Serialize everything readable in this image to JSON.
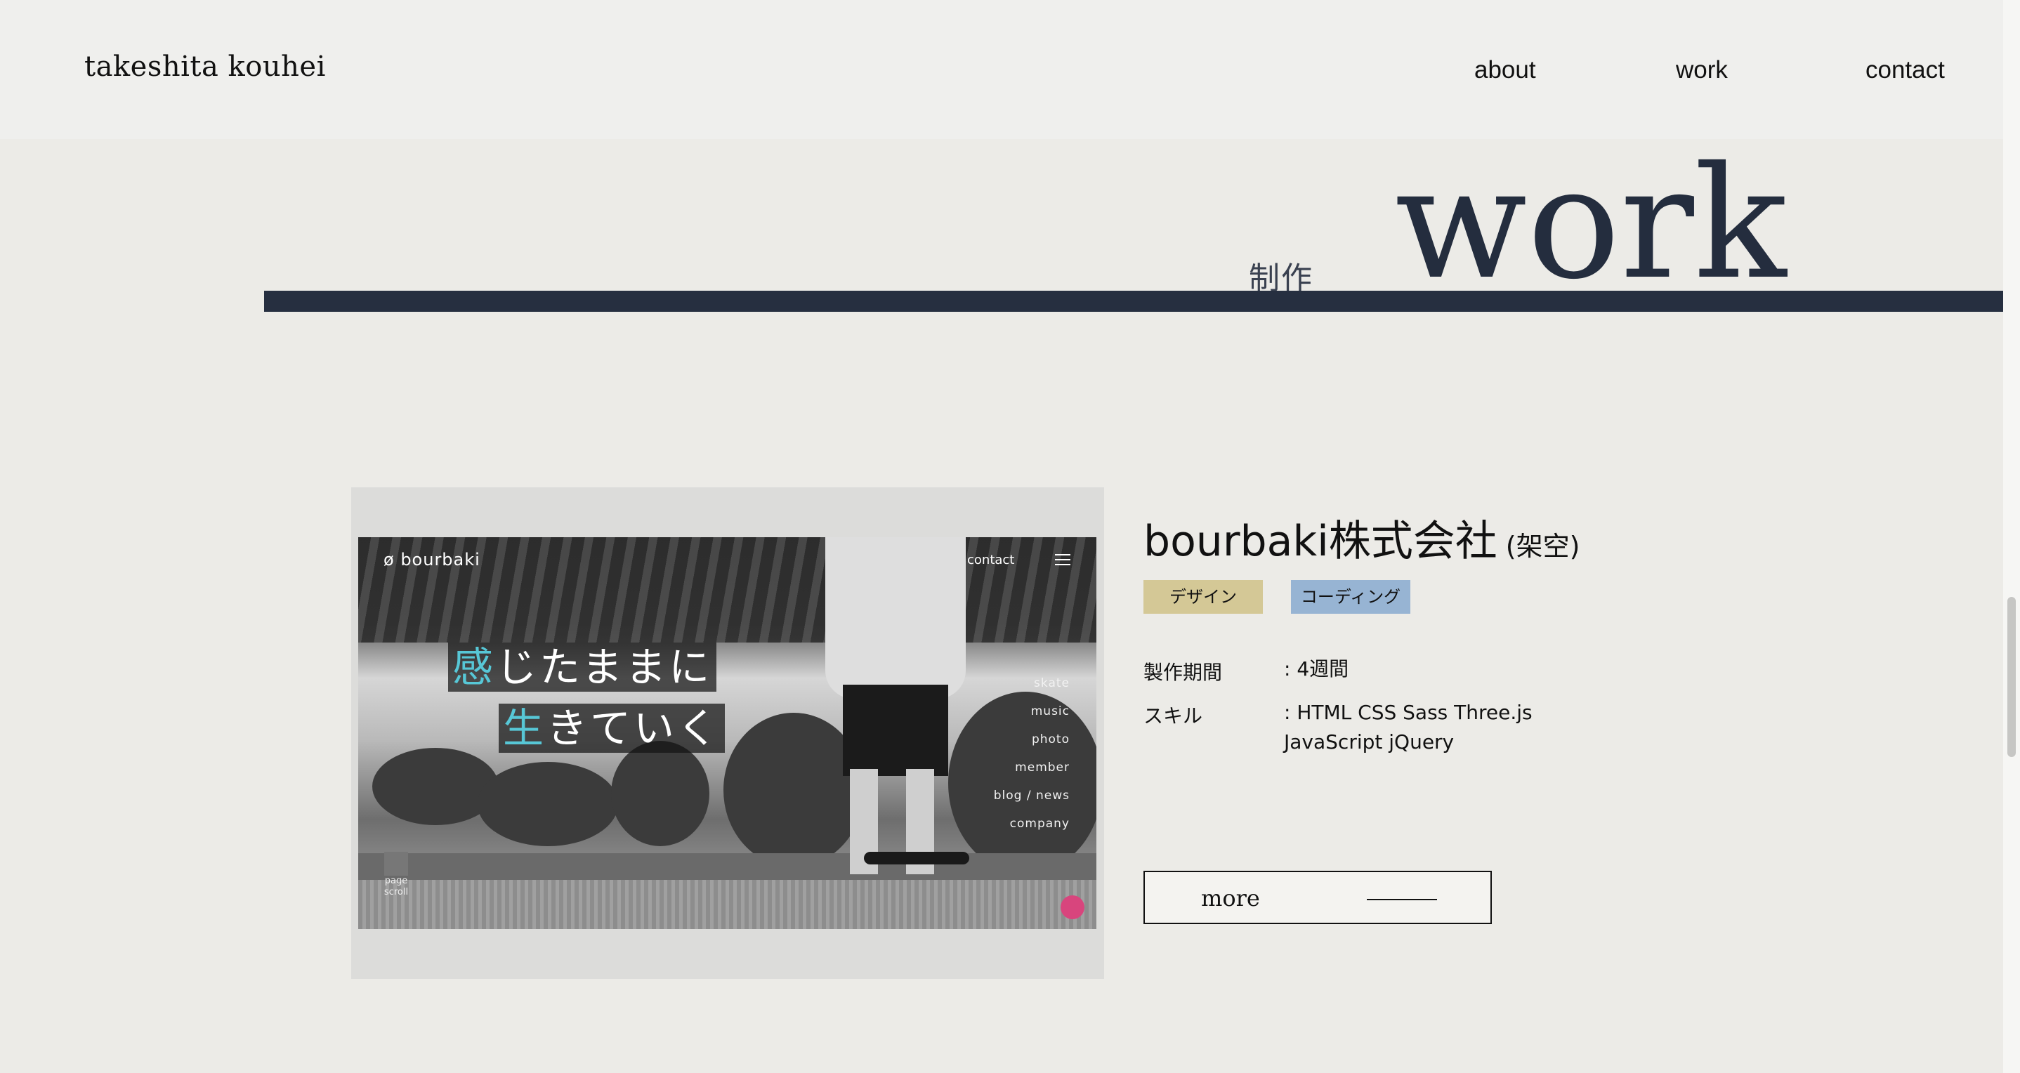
{
  "header": {
    "logo": "takeshita kouhei",
    "nav": [
      {
        "label": "about"
      },
      {
        "label": "work"
      },
      {
        "label": "contact"
      }
    ]
  },
  "section": {
    "subtitle": "制作",
    "title": "work"
  },
  "work_item": {
    "title": "bourbaki株式会社",
    "title_note": "(架空)",
    "tags": [
      "デザイン",
      "コーディング"
    ],
    "meta": {
      "period_label": "製作期間",
      "period_value": ": 4週間",
      "skill_label": "スキル",
      "skill_value_line1": ": HTML CSS Sass Three.js",
      "skill_value_line2": "JavaScript jQuery"
    },
    "more_label": "more",
    "thumbnail": {
      "brand": "ø bourbaki",
      "contact": "contact",
      "copy_line1_accent": "感",
      "copy_line1_rest": "じたままに",
      "copy_line2_accent": "生",
      "copy_line2_rest": "きていく",
      "menu": [
        "skate",
        "music",
        "photo",
        "member",
        "blog / news",
        "company"
      ],
      "scroll_text": "page scroll"
    }
  },
  "colors": {
    "background": "#ecebe7",
    "navy": "#262f40",
    "tag_design": "#d4c896",
    "tag_coding": "#97b4d3",
    "accent_cyan": "#57c7d6"
  }
}
